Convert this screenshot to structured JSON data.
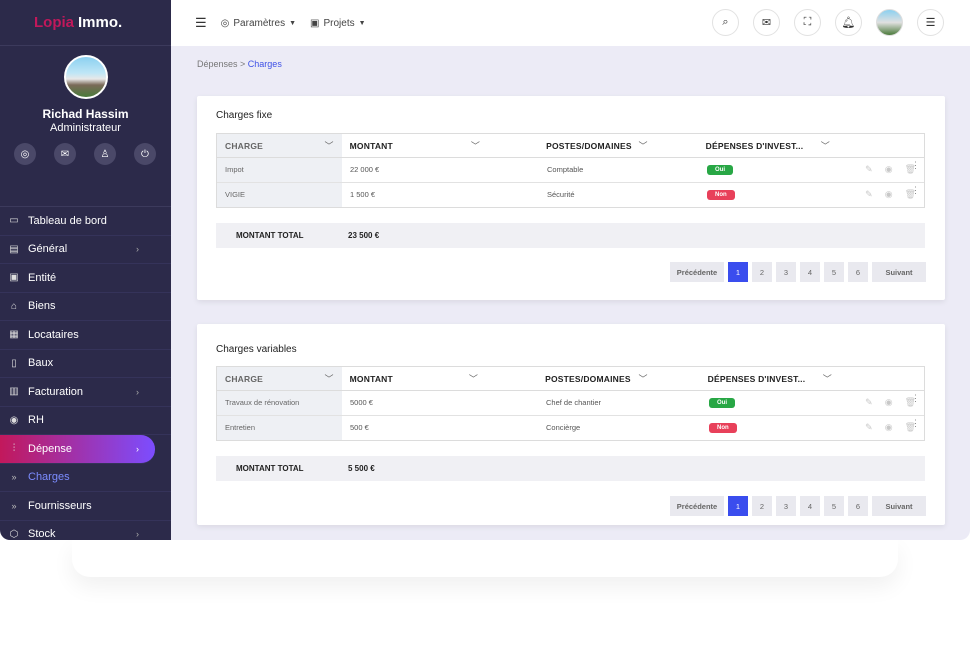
{
  "app": {
    "logo_part1": "Lopia",
    "logo_part2": "Immo."
  },
  "user": {
    "name": "Richad Hassim",
    "role": "Administrateur"
  },
  "user_icons": [
    "settings-icon",
    "mail-icon",
    "user-icon",
    "power-icon"
  ],
  "sidebar": {
    "items": [
      {
        "label": "Tableau de bord",
        "icon": "monitor-icon",
        "chevron": ""
      },
      {
        "label": "Général",
        "icon": "card-icon",
        "chevron": "›"
      },
      {
        "label": "Entité",
        "icon": "id-icon",
        "chevron": ""
      },
      {
        "label": "Biens",
        "icon": "building-icon",
        "chevron": ""
      },
      {
        "label": "Locataires",
        "icon": "contacts-icon",
        "chevron": ""
      },
      {
        "label": "Baux",
        "icon": "document-icon",
        "chevron": ""
      },
      {
        "label": "Facturation",
        "icon": "invoice-icon",
        "chevron": "›"
      },
      {
        "label": "RH",
        "icon": "person-icon",
        "chevron": ""
      },
      {
        "label": "Dépense",
        "icon": "chart-icon",
        "chevron": "›"
      },
      {
        "label": "Charges",
        "icon": "bullet",
        "chevron": ""
      },
      {
        "label": "Fournisseurs",
        "icon": "bullet",
        "chevron": ""
      },
      {
        "label": "Stock",
        "icon": "box-icon",
        "chevron": "›"
      }
    ]
  },
  "topbar": {
    "parametres": "Paramètres",
    "projets": "Projets"
  },
  "breadcrumb": {
    "parent": "Dépenses",
    "sep": " > ",
    "current": "Charges"
  },
  "headers": [
    "CHARGE",
    "MONTANT",
    "POSTES/DOMAINES",
    "DÉPENSES D'INVEST..."
  ],
  "fixe": {
    "title": "Charges fixe",
    "rows": [
      {
        "charge": "Impot",
        "montant": "22 000  €",
        "poste": "Comptable",
        "invest": "Oui"
      },
      {
        "charge": "VIGIE",
        "montant": "1 500 €",
        "poste": "Sécurité",
        "invest": "Non"
      }
    ],
    "total_label": "MONTANT TOTAL",
    "total_value": "23 500 €"
  },
  "variables": {
    "title": "Charges variables",
    "rows": [
      {
        "charge": "Travaux de rénovation",
        "montant": "5000 €",
        "poste": "Chef de chantier",
        "invest": "Oui"
      },
      {
        "charge": "Entretien",
        "montant": "500 €",
        "poste": "Concièrge",
        "invest": "Non"
      }
    ],
    "total_label": "MONTANT TOTAL",
    "total_value": "5 500 €"
  },
  "pagination": {
    "prev": "Précédente",
    "pages": [
      "1",
      "2",
      "3",
      "4",
      "5",
      "6"
    ],
    "next": "Suivant",
    "active": "1"
  }
}
